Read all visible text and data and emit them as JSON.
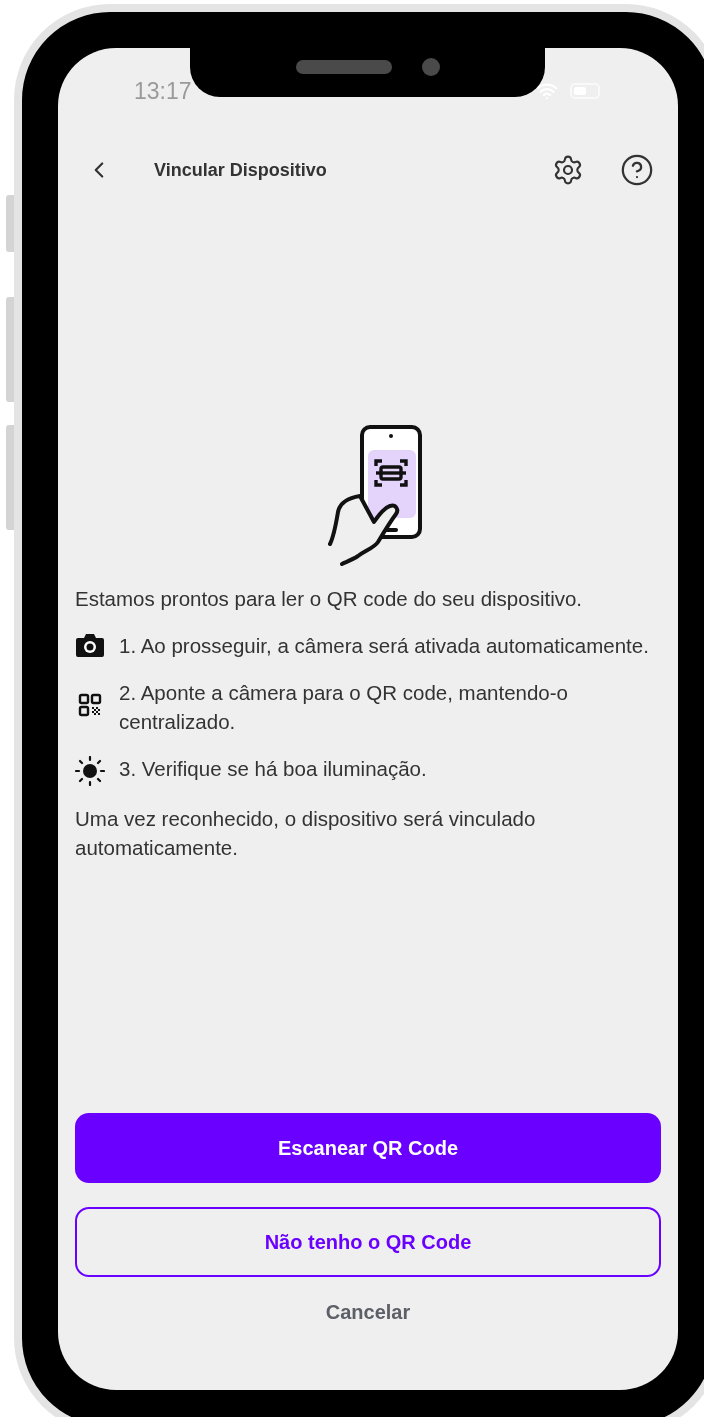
{
  "status_bar": {
    "time": "13:17"
  },
  "header": {
    "title": "Vincular Dispositivo"
  },
  "intro": "Estamos prontos para ler o QR code do seu dispositivo.",
  "steps": [
    {
      "kind": "camera",
      "text": "1. Ao prosseguir, a câmera será ativada automaticamente."
    },
    {
      "kind": "qr",
      "text": "2. Aponte a câmera para o QR code, mantendo-o centralizado."
    },
    {
      "kind": "sun",
      "text": "3. Verifique se há boa iluminação."
    }
  ],
  "outro": "Uma vez reconhecido, o dispositivo será vinculado automaticamente.",
  "buttons": [
    {
      "kind": "primary",
      "label": "Escanear QR Code"
    },
    {
      "kind": "outline",
      "label": "Não tenho o QR Code"
    },
    {
      "kind": "text",
      "label": "Cancelar"
    }
  ]
}
